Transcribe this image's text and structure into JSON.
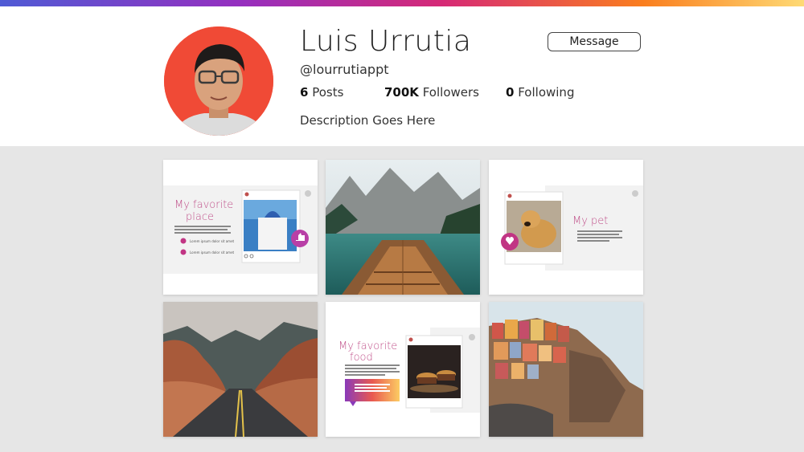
{
  "profile": {
    "name": "Luis Urrutia",
    "handle": "@lourrutiappt",
    "message_label": "Message",
    "posts_count": "6",
    "posts_label": "Posts",
    "followers_count": "700K",
    "followers_label": "Followers",
    "following_count": "0",
    "following_label": "Following",
    "description": "Description Goes Here"
  },
  "posts": [
    {
      "type": "slide",
      "title_line1": "My favorite",
      "title_line2": "place",
      "bullet1": "Lorem ipsum dolor sit amet",
      "bullet2": "Lorem ipsum dolor sit amet"
    },
    {
      "type": "photo",
      "subject": "boat on mountain lake"
    },
    {
      "type": "slide",
      "title": "My pet"
    },
    {
      "type": "photo",
      "subject": "desert road"
    },
    {
      "type": "slide",
      "title_line1": "My favorite",
      "title_line2": "food"
    },
    {
      "type": "photo",
      "subject": "coastal cliff village"
    }
  ],
  "colors": {
    "accent_gradient": [
      "#4f5bd5",
      "#962fbf",
      "#d62976",
      "#fa7e1e",
      "#feda75"
    ],
    "avatar_bg": "#f04a36",
    "grid_bg": "#e6e6e6"
  }
}
